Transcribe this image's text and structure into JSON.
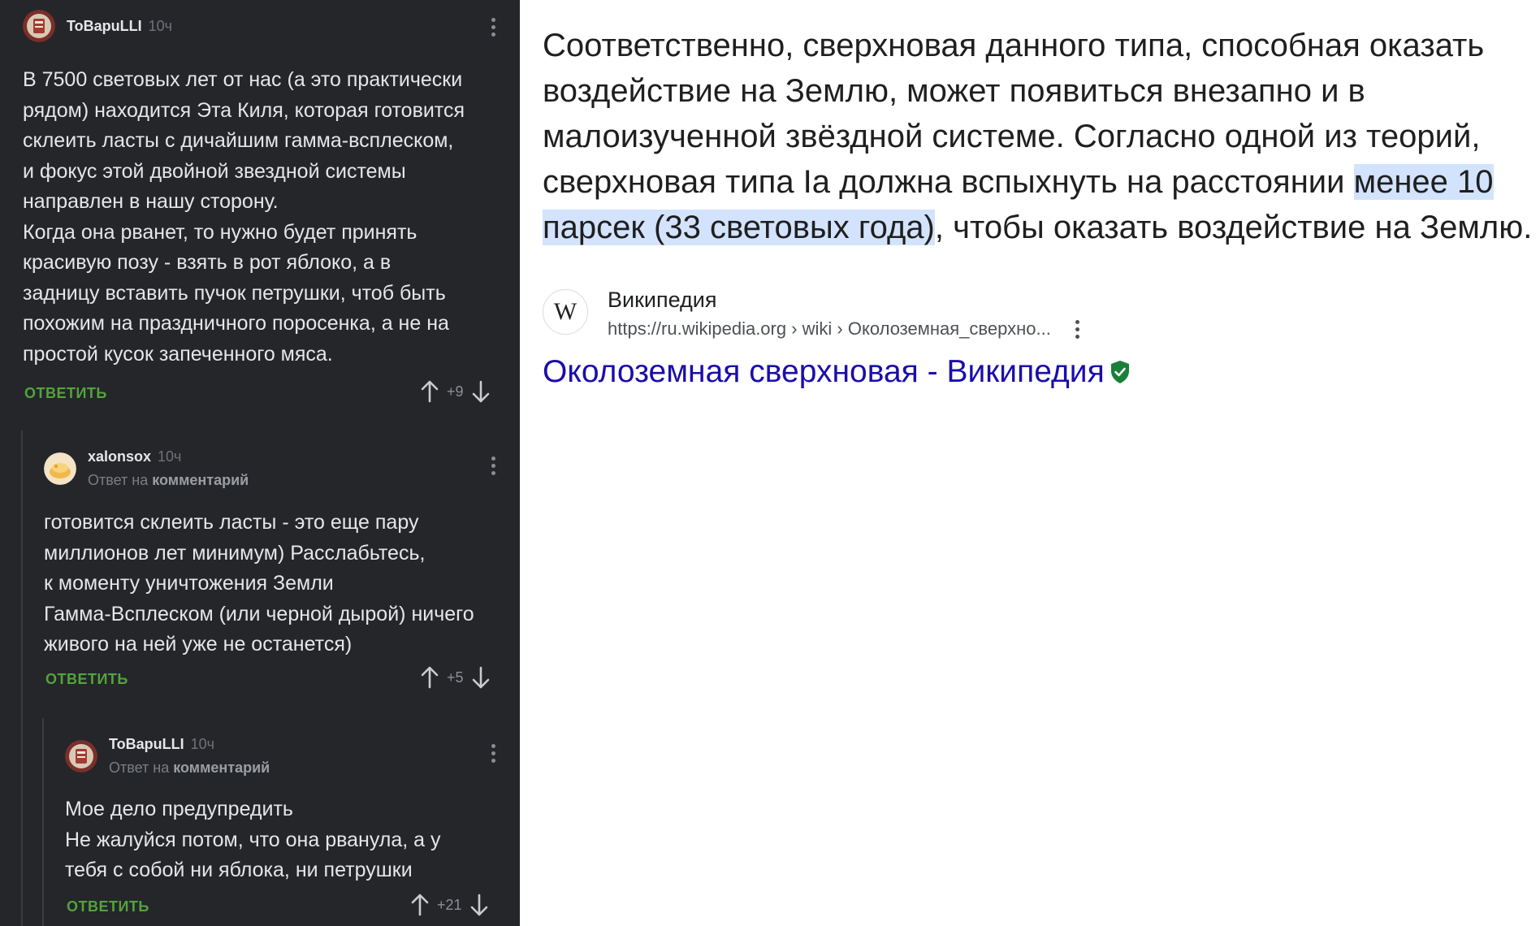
{
  "comments": [
    {
      "author": "ToBapuLLI",
      "time": "10ч",
      "reply_prefix": "",
      "reply_target": "",
      "text": "В 7500 световых лет от нас (а это практически\nрядом) находится Эта Киля, которая готовится\nсклеить ласты с дичайшим гамма-всплеском,\nи фокус этой двойной звездной системы\nнаправлен в нашу сторону.\nКогда она рванет, то нужно будет принять\nкрасивую позу - взять в рот яблоко, а в\nзадницу вставить пучок петрушки, чтоб быть\nпохожим на праздничного поросенка, а не на\nпростой кусок запеченного мяса.",
      "reply_label": "ОТВЕТИТЬ",
      "score": "+9"
    },
    {
      "author": "xalonsox",
      "time": "10ч",
      "reply_prefix": "Ответ на",
      "reply_target": "комментарий",
      "text": "готовится склеить ласты - это еще пару\nмиллионов лет минимум) Расслабьтесь,\nк моменту уничтожения Земли\nГамма-Всплеском (или черной дырой) ничего\nживого на ней уже не останется)",
      "reply_label": "ОТВЕТИТЬ",
      "score": "+5"
    },
    {
      "author": "ToBapuLLI",
      "time": "10ч",
      "reply_prefix": "Ответ на",
      "reply_target": "комментарий",
      "text": "Мое дело предупредить\nНе жалуйся потом, что она рванула, а у\nтебя с собой ни яблока, ни петрушки",
      "reply_label": "ОТВЕТИТЬ",
      "score": "+21"
    }
  ],
  "search_result": {
    "snippet_before": "Соответственно, сверхновая данного типа, способная оказать воздействие на Землю, может появиться внезапно и в малоизученной звёздной системе. Согласно одной из теорий, сверхновая типа Ia должна вспыхнуть на расстоянии ",
    "snippet_highlight": "менее 10 парсек (33 световых года)",
    "snippet_after": ", чтобы оказать воздействие на Землю.",
    "source_name": "Википедия",
    "source_logo": "W",
    "source_url": "https://ru.wikipedia.org › wiki › Околоземная_сверхно...",
    "title": "Околоземная сверхновая - Википедия",
    "highlight_color": "#d3e3fd",
    "link_color": "#1a0dab",
    "verified_color": "#188038"
  },
  "colors": {
    "panel_bg": "#24262a",
    "reply_green": "#53a33c"
  }
}
